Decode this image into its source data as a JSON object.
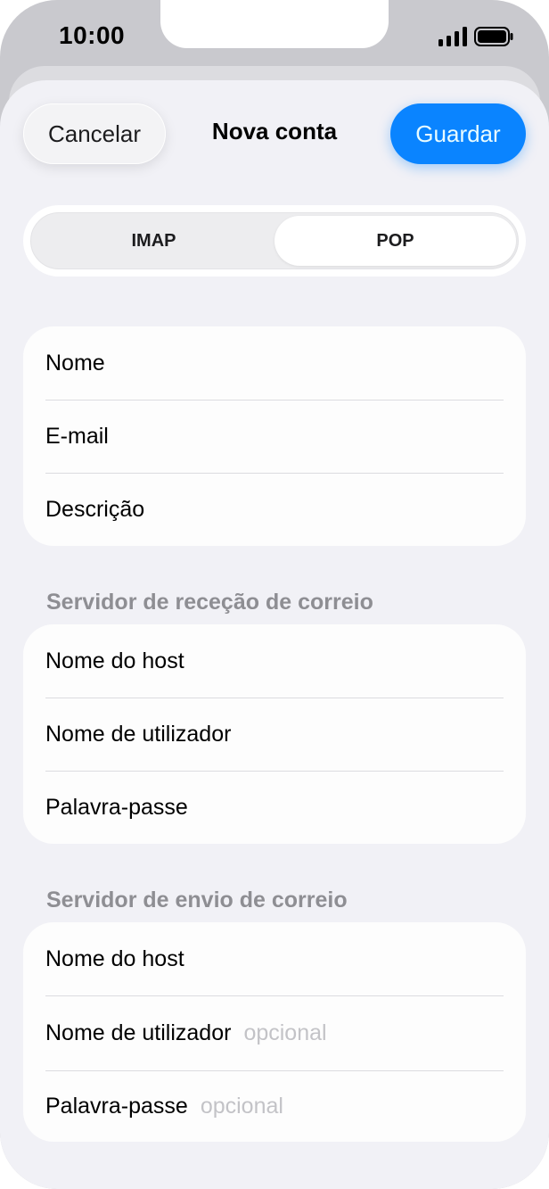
{
  "status_bar": {
    "time": "10:00"
  },
  "nav": {
    "cancel_label": "Cancelar",
    "title": "Nova conta",
    "save_label": "Guardar"
  },
  "segments": {
    "items": [
      "IMAP",
      "POP"
    ],
    "selected": "POP"
  },
  "account": {
    "rows": [
      {
        "label": "Nome"
      },
      {
        "label": "E-mail"
      },
      {
        "label": "Descrição"
      }
    ]
  },
  "incoming": {
    "header": "Servidor de receção de correio",
    "rows": [
      {
        "label": "Nome do host"
      },
      {
        "label": "Nome de utilizador"
      },
      {
        "label": "Palavra-passe"
      }
    ]
  },
  "outgoing": {
    "header": "Servidor de envio de correio",
    "rows": [
      {
        "label": "Nome do host"
      },
      {
        "label": "Nome de utilizador",
        "placeholder": "opcional"
      },
      {
        "label": "Palavra-passe",
        "placeholder": "opcional"
      }
    ]
  },
  "colors": {
    "accent": "#0a84ff",
    "sheet_background": "#f1f1f6",
    "placeholder": "#c3c3c7",
    "section_header": "#8e8e93"
  },
  "icons": [
    "signal-icon",
    "battery-icon"
  ]
}
